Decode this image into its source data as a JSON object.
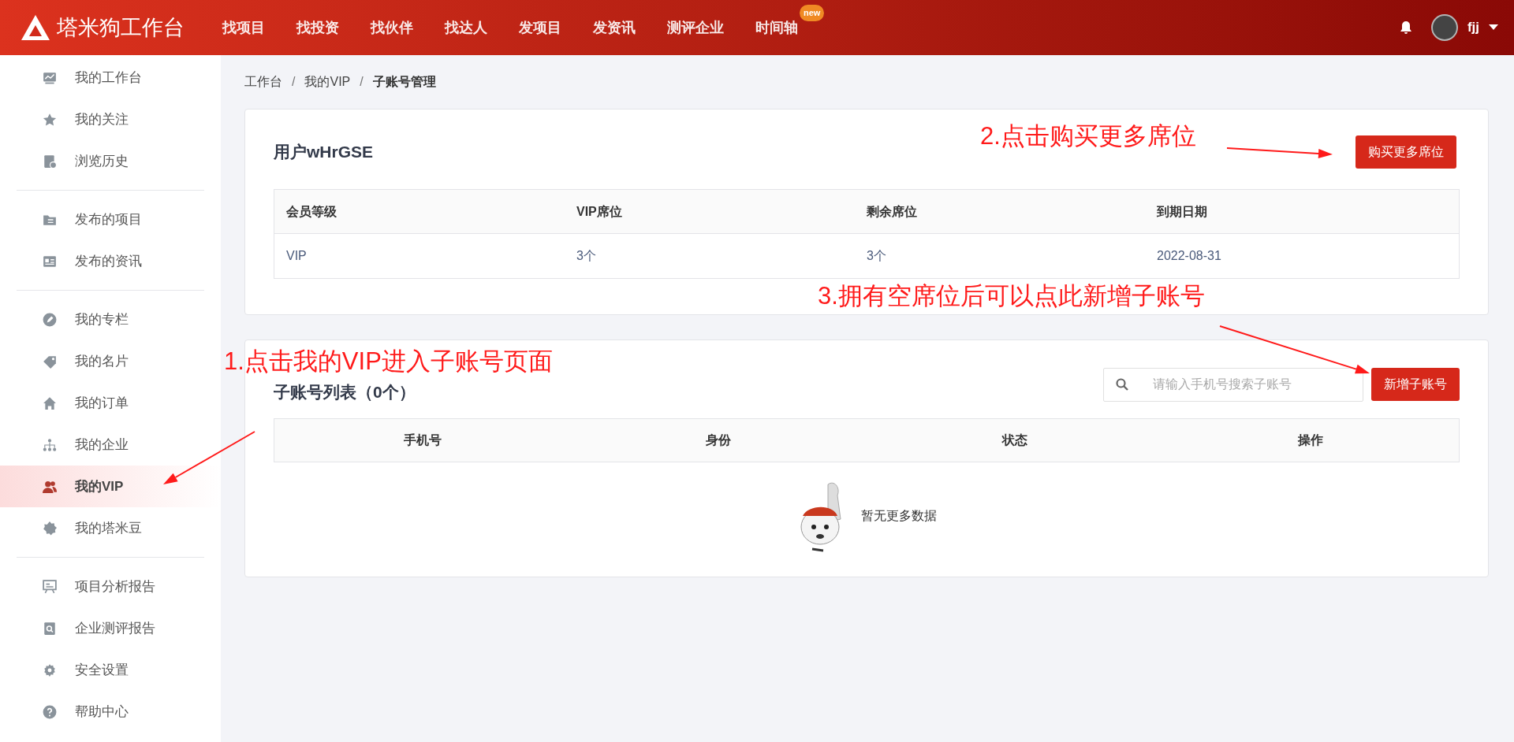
{
  "header": {
    "logo_text": "塔米狗工作台",
    "nav": [
      {
        "label": "找项目"
      },
      {
        "label": "找投资"
      },
      {
        "label": "找伙伴"
      },
      {
        "label": "找达人"
      },
      {
        "label": "发项目"
      },
      {
        "label": "发资讯"
      },
      {
        "label": "测评企业"
      },
      {
        "label": "时间轴",
        "badge": "new"
      }
    ],
    "user_name": "fjj"
  },
  "sidebar": {
    "groups": [
      [
        {
          "label": "我的工作台",
          "selected": false
        },
        {
          "label": "我的关注",
          "selected": false
        },
        {
          "label": "浏览历史",
          "selected": false
        }
      ],
      [
        {
          "label": "发布的项目",
          "selected": false
        },
        {
          "label": "发布的资讯",
          "selected": false
        }
      ],
      [
        {
          "label": "我的专栏",
          "selected": false
        },
        {
          "label": "我的名片",
          "selected": false
        },
        {
          "label": "我的订单",
          "selected": false
        },
        {
          "label": "我的企业",
          "selected": false
        },
        {
          "label": "我的VIP",
          "selected": true
        },
        {
          "label": "我的塔米豆",
          "selected": false
        }
      ],
      [
        {
          "label": "项目分析报告",
          "selected": false
        },
        {
          "label": "企业测评报告",
          "selected": false
        },
        {
          "label": "安全设置",
          "selected": false
        },
        {
          "label": "帮助中心",
          "selected": false
        }
      ]
    ]
  },
  "breadcrumb": [
    {
      "kind": "link",
      "label": "工作台"
    },
    {
      "kind": "separator",
      "label": "/"
    },
    {
      "kind": "link",
      "label": "我的VIP"
    },
    {
      "kind": "separator",
      "label": "/"
    },
    {
      "kind": "current",
      "label": "子账号管理"
    }
  ],
  "vip_card": {
    "title": "用户wHrGSE",
    "button": "购买更多席位",
    "columns": [
      "会员等级",
      "VIP席位",
      "剩余席位",
      "到期日期"
    ],
    "rows": [
      [
        "VIP",
        "3个",
        "3个",
        "2022-08-31"
      ]
    ]
  },
  "sub_accounts": {
    "title": "子账号列表（0个）",
    "search": {
      "placeholder": "请输入手机号搜索子账号"
    },
    "button": "新增子账号",
    "columns": [
      "手机号",
      "身份",
      "状态",
      "操作"
    ],
    "empty_text": "暂无更多数据"
  },
  "annotations": [
    {
      "text": "1.点击我的VIP进入子账号页面"
    },
    {
      "text": "2.点击购买更多席位"
    },
    {
      "text": "3.拥有空席位后可以点此新增子账号"
    }
  ]
}
